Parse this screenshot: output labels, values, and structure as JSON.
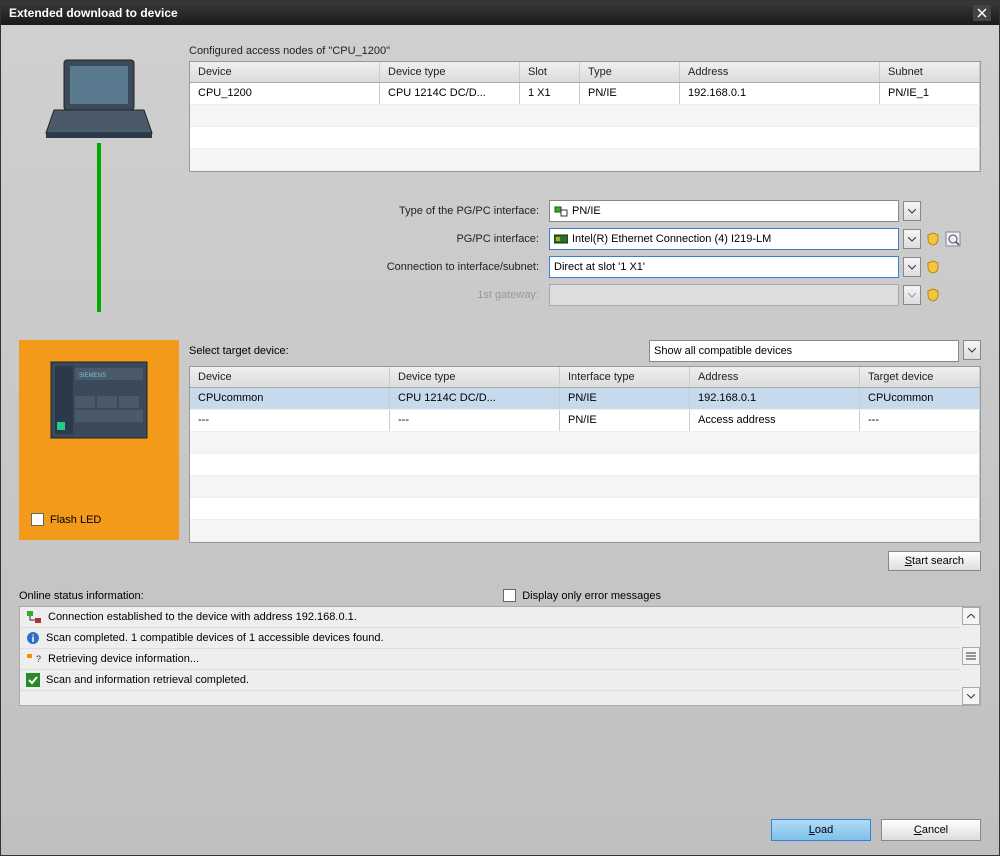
{
  "title": "Extended download to device",
  "configNodes": {
    "heading": "Configured access nodes of \"CPU_1200\"",
    "headers": [
      "Device",
      "Device type",
      "Slot",
      "Type",
      "Address",
      "Subnet"
    ],
    "rows": [
      {
        "device": "CPU_1200",
        "deviceType": "CPU 1214C DC/D...",
        "slot": "1 X1",
        "type": "PN/IE",
        "address": "192.168.0.1",
        "subnet": "PN/IE_1"
      }
    ]
  },
  "interface": {
    "typeLabel": "Type of the PG/PC interface:",
    "typeValue": "PN/IE",
    "pgpcLabel": "PG/PC interface:",
    "pgpcValue": "Intel(R) Ethernet Connection (4) I219-LM",
    "connLabel": "Connection to interface/subnet:",
    "connValue": "Direct at slot '1 X1'",
    "gatewayLabel": "1st gateway:",
    "gatewayValue": ""
  },
  "target": {
    "selectLabel": "Select target device:",
    "filterValue": "Show all compatible devices",
    "headers": [
      "Device",
      "Device type",
      "Interface type",
      "Address",
      "Target device"
    ],
    "rows": [
      {
        "device": "CPUcommon",
        "deviceType": "CPU 1214C DC/D...",
        "ifType": "PN/IE",
        "address": "192.168.0.1",
        "target": "CPUcommon",
        "selected": true
      },
      {
        "device": "---",
        "deviceType": "---",
        "ifType": "PN/IE",
        "address": "Access address",
        "target": "---"
      }
    ]
  },
  "flashLed": "Flash LED",
  "startSearch": "Start search",
  "status": {
    "heading": "Online status information:",
    "displayErrors": "Display only error messages",
    "items": [
      {
        "icon": "connect",
        "text": "Connection established to the device with address 192.168.0.1."
      },
      {
        "icon": "info",
        "text": "Scan completed. 1 compatible devices of 1 accessible devices found."
      },
      {
        "icon": "retrieve",
        "text": "Retrieving device information..."
      },
      {
        "icon": "check",
        "text": "Scan and information retrieval completed."
      }
    ]
  },
  "buttons": {
    "load": "Load",
    "cancel": "Cancel"
  }
}
